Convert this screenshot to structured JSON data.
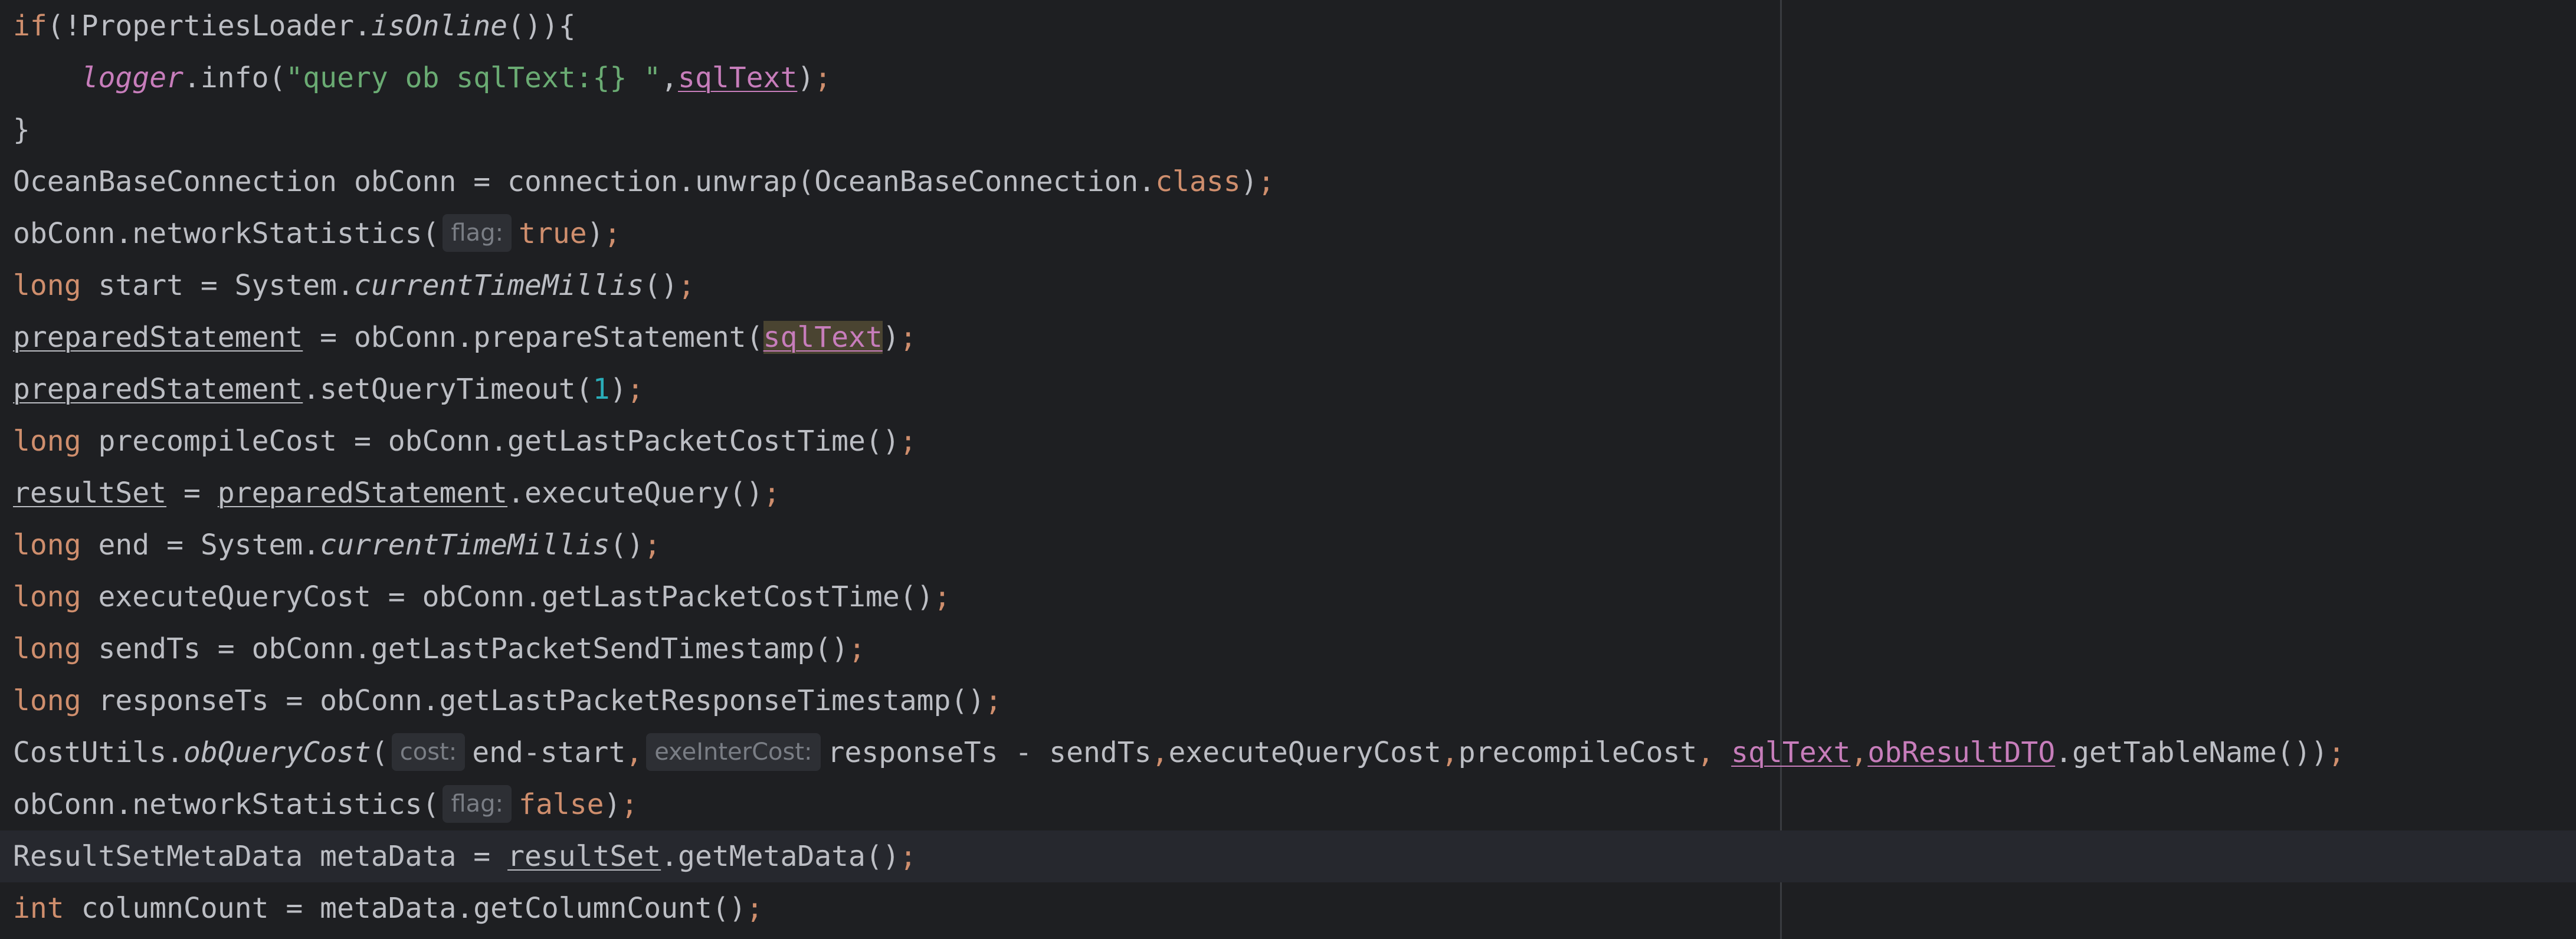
{
  "colors": {
    "background": "#1e1f22",
    "current_line": "#26282e",
    "text": "#bcbec4",
    "keyword": "#cf8e6d",
    "string": "#6aab73",
    "number": "#2aacb8",
    "field": "#c77dbb",
    "hint_bg": "#2d2f34",
    "hint_text": "#7a7e85"
  },
  "lines": [
    [
      {
        "t": "if",
        "c": "kw"
      },
      {
        "t": "(!PropertiesLoader."
      },
      {
        "t": "isOnline",
        "c": "italic"
      },
      {
        "t": "()){"
      }
    ],
    [
      {
        "t": "    "
      },
      {
        "t": "logger",
        "c": "field italic"
      },
      {
        "t": ".info("
      },
      {
        "t": "\"query ob sqlText:{} \"",
        "c": "str"
      },
      {
        "t": ","
      },
      {
        "t": "sqlText",
        "c": "field u"
      },
      {
        "t": ")"
      },
      {
        "t": ";",
        "c": "kw"
      }
    ],
    [
      {
        "t": "}"
      }
    ],
    [
      {
        "t": "OceanBaseConnection obConn = connection.unwrap(OceanBaseConnection."
      },
      {
        "t": "class",
        "c": "kw"
      },
      {
        "t": ")"
      },
      {
        "t": ";",
        "c": "kw"
      }
    ],
    [
      {
        "t": "obConn.networkStatistics("
      },
      {
        "hint": "flag:"
      },
      {
        "t": "true",
        "c": "kw"
      },
      {
        "t": ")"
      },
      {
        "t": ";",
        "c": "kw"
      }
    ],
    [
      {
        "t": "long",
        "c": "kw"
      },
      {
        "t": " start = System."
      },
      {
        "t": "currentTimeMillis",
        "c": "italic"
      },
      {
        "t": "()"
      },
      {
        "t": ";",
        "c": "kw"
      }
    ],
    [
      {
        "t": "preparedStatement",
        "c": "u"
      },
      {
        "t": " = obConn.prepareStatement("
      },
      {
        "t": "sqlText",
        "c": "field u hl"
      },
      {
        "t": ")"
      },
      {
        "t": ";",
        "c": "kw"
      }
    ],
    [
      {
        "t": "preparedStatement",
        "c": "u"
      },
      {
        "t": ".setQueryTimeout("
      },
      {
        "t": "1",
        "c": "num"
      },
      {
        "t": ")"
      },
      {
        "t": ";",
        "c": "kw"
      }
    ],
    [
      {
        "t": "long",
        "c": "kw"
      },
      {
        "t": " precompileCost = obConn.getLastPacketCostTime()"
      },
      {
        "t": ";",
        "c": "kw"
      }
    ],
    [
      {
        "t": "resultSet",
        "c": "u"
      },
      {
        "t": " = "
      },
      {
        "t": "preparedStatement",
        "c": "u"
      },
      {
        "t": ".executeQuery()"
      },
      {
        "t": ";",
        "c": "kw"
      }
    ],
    [
      {
        "t": "long",
        "c": "kw"
      },
      {
        "t": " end = System."
      },
      {
        "t": "currentTimeMillis",
        "c": "italic"
      },
      {
        "t": "()"
      },
      {
        "t": ";",
        "c": "kw"
      }
    ],
    [
      {
        "t": "long",
        "c": "kw"
      },
      {
        "t": " executeQueryCost = obConn.getLastPacketCostTime()"
      },
      {
        "t": ";",
        "c": "kw"
      }
    ],
    [
      {
        "t": "long",
        "c": "kw"
      },
      {
        "t": " sendTs = obConn.getLastPacketSendTimestamp()"
      },
      {
        "t": ";",
        "c": "kw"
      }
    ],
    [
      {
        "t": "long",
        "c": "kw"
      },
      {
        "t": " responseTs = obConn.getLastPacketResponseTimestamp()"
      },
      {
        "t": ";",
        "c": "kw"
      }
    ],
    [
      {
        "t": "CostUtils."
      },
      {
        "t": "obQueryCost",
        "c": "italic"
      },
      {
        "t": "("
      },
      {
        "hint": "cost:"
      },
      {
        "t": "end-start"
      },
      {
        "t": ",",
        "c": "kw"
      },
      {
        "hint": "exeInterCost:"
      },
      {
        "t": "responseTs - sendTs"
      },
      {
        "t": ",",
        "c": "kw"
      },
      {
        "t": "executeQueryCost"
      },
      {
        "t": ",",
        "c": "kw"
      },
      {
        "t": "precompileCost"
      },
      {
        "t": ", ",
        "c": "kw"
      },
      {
        "t": "sqlText",
        "c": "field u"
      },
      {
        "t": ",",
        "c": "kw"
      },
      {
        "t": "obResultDTO",
        "c": "field u"
      },
      {
        "t": ".getTableName())"
      },
      {
        "t": ";",
        "c": "kw"
      }
    ],
    [
      {
        "t": "obConn.networkStatistics("
      },
      {
        "hint": "flag:"
      },
      {
        "t": "false",
        "c": "kw"
      },
      {
        "t": ")"
      },
      {
        "t": ";",
        "c": "kw"
      }
    ],
    [
      {
        "t": "ResultSetMetaData metaData = "
      },
      {
        "t": "resultSet",
        "c": "u"
      },
      {
        "t": ".getMetaData()"
      },
      {
        "t": ";",
        "c": "kw"
      }
    ],
    [
      {
        "t": "int",
        "c": "kw"
      },
      {
        "t": " columnCount = metaData.getColumnCount()"
      },
      {
        "t": ";",
        "c": "kw"
      }
    ]
  ],
  "current_line_index": 16
}
